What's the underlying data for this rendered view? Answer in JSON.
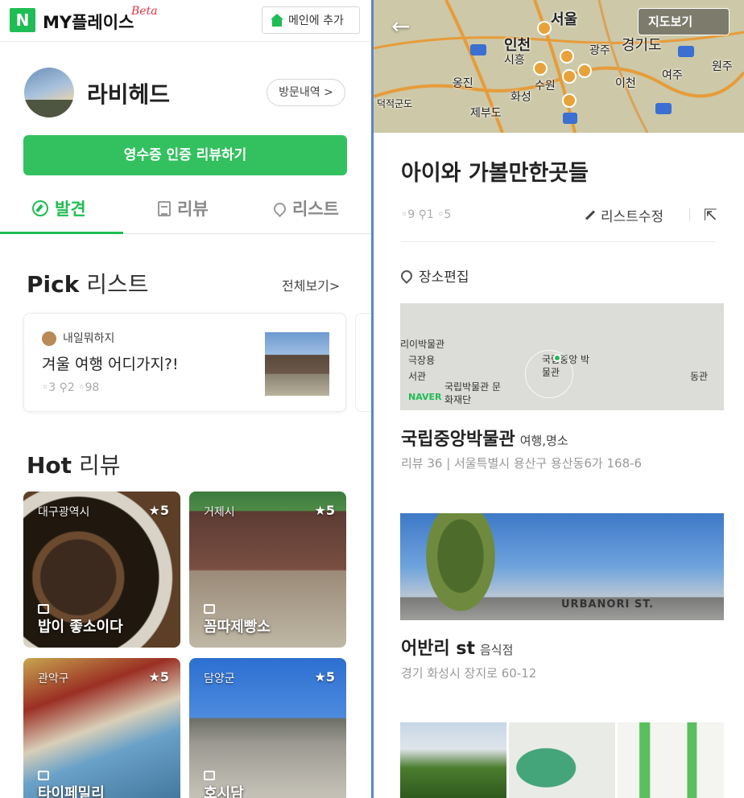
{
  "left": {
    "app_title": "MY플레이스",
    "beta": "Beta",
    "logo": "N",
    "add_main": "메인에 추가",
    "user_name": "라비헤드",
    "visit_history": "방문내역 >",
    "receipt_review": "영수증 인증 리뷰하기",
    "tabs": [
      {
        "label": "발견",
        "icon": "compass-icon",
        "active": true
      },
      {
        "label": "리뷰",
        "icon": "document-icon",
        "active": false
      },
      {
        "label": "리스트",
        "icon": "location-pin-icon",
        "active": false
      }
    ],
    "pick": {
      "title_bold": "Pick",
      "title_light": " 리스트",
      "see_all": "전체보기>",
      "card": {
        "author": "내일뭐하지",
        "title": "겨울 여행 어디가지?!",
        "stats": "◦3 ⚲2 ◦98"
      }
    },
    "hot": {
      "title_bold": "Hot",
      "title_light": " 리뷰",
      "tiles": [
        {
          "region": "대구광역시",
          "rating": "★5",
          "name": "밥이 좋소이다"
        },
        {
          "region": "거제시",
          "rating": "★5",
          "name": "꼼따제빵소"
        },
        {
          "region": "관악구",
          "rating": "★5",
          "name": "타이페밀리"
        },
        {
          "region": "담양군",
          "rating": "★5",
          "name": "호시담"
        }
      ]
    }
  },
  "right": {
    "map_button": "지도보기",
    "map_labels": {
      "seoul": "서울",
      "incheon": "인천",
      "gyeonggi": "경기도",
      "gwangju": "광주",
      "siheung": "시흥",
      "suwon": "수원",
      "hwaseong": "화성",
      "icheon": "이천",
      "yeoju": "여주",
      "wonju": "원주",
      "ongjin": "옹진",
      "jebudo": "제부도",
      "deokjeok": "덕적군도"
    },
    "list_title": "아이와 가볼만한곳들",
    "list_stats": "◦9 ⚲1 ◦5",
    "edit_list": "리스트수정",
    "edit_places": "장소편집",
    "places": [
      {
        "name": "국립중앙박물관",
        "category": "여행,명소",
        "sub": "리뷰 36 | 서울특별시 용산구 용산동6가 168-6",
        "map_labels": [
          "리이박물관",
          "극장용",
          "서관",
          "국립중앙 박물관",
          "국립박물관 문화재단",
          "동관"
        ]
      },
      {
        "name": "어반리 st",
        "category": "음식점",
        "sub": "경기 화성시 장지로 60-12",
        "sign": "URBANORI ST."
      }
    ],
    "naver": "NAVER"
  },
  "colors": {
    "brand_green": "#1fbd53",
    "button_green": "#33c15f",
    "divider_blue": "#5b86c9"
  }
}
